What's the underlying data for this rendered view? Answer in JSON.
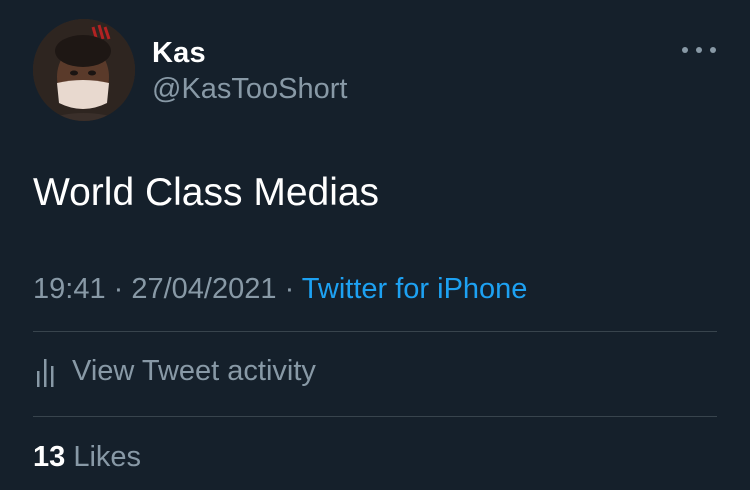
{
  "tweet": {
    "author": {
      "name": "Kas",
      "handle": "@KasTooShort"
    },
    "text": "World Class Medias",
    "time": "19:41",
    "separator1": " · ",
    "date": "27/04/2021",
    "separator2": " · ",
    "source": "Twitter for iPhone"
  },
  "activity": {
    "label": "View Tweet activity",
    "icon": "bar-chart-icon"
  },
  "likes": {
    "count": "13",
    "label": " Likes"
  },
  "menu": {
    "icon": "more-icon"
  },
  "colors": {
    "background": "#15202b",
    "text_primary": "#ffffff",
    "text_secondary": "#8899a6",
    "link": "#1da1f2",
    "divider": "#38444d"
  }
}
